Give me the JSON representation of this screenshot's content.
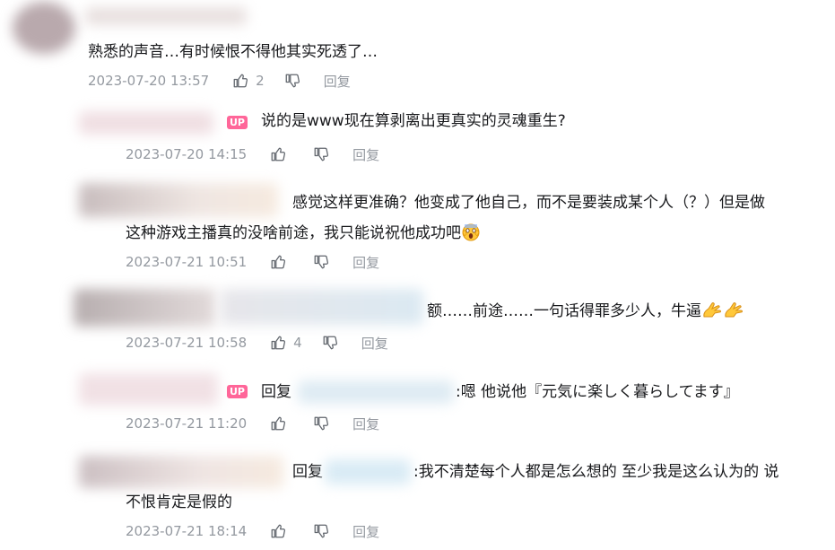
{
  "comments": [
    {
      "text": "熟悉的声音…有时候恨不得他其实死透了…",
      "time": "2023-07-20 13:57",
      "likes": "2",
      "reply_label": "回复"
    },
    {
      "up_badge": "UP",
      "text": "说的是www现在算剥离出更真实的灵魂重生?",
      "time": "2023-07-20 14:15",
      "likes": "",
      "reply_label": "回复"
    },
    {
      "text_line1": "感觉这样更准确？他变成了他自己，而不是要装成某个人（？）但是做",
      "text_line2": "这种游戏主播真的没啥前途，我只能说祝他成功吧",
      "time": "2023-07-21 10:51",
      "likes": "",
      "reply_label": "回复"
    },
    {
      "text": "额……前途……一句话得罪多少人，牛逼",
      "time": "2023-07-21 10:58",
      "likes": "4",
      "reply_label": "回复"
    },
    {
      "up_badge": "UP",
      "reply_prefix": "回复",
      "text": ":嗯 他说他『元気に楽しく暮らしてます』",
      "time": "2023-07-21 11:20",
      "likes": "",
      "reply_label": "回复"
    },
    {
      "reply_prefix": "回复",
      "text_line1": ":我不清楚每个人都是怎么想的 至少我是这么认为的 说",
      "text_line2": "不恨肯定是假的",
      "time": "2023-07-21 18:14",
      "likes": "",
      "reply_label": "回复"
    }
  ],
  "icons": {
    "like": "thumbs-up-icon",
    "dislike": "thumbs-down-icon",
    "emoji_scream": "scream-emoji",
    "emoji_clap": "ok-hand-emoji"
  },
  "colors": {
    "up_badge": "#ff6699",
    "meta_text": "#9499a0",
    "body_text": "#18191c"
  }
}
